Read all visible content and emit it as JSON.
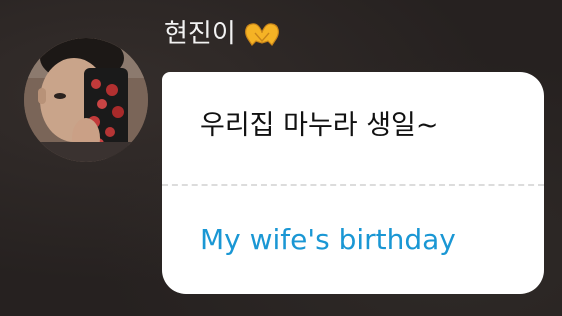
{
  "message": {
    "sender_name": "현진이",
    "sender_emoji_icon": "heart-hands-icon",
    "original_text": "우리집 마누라 생일~",
    "translated_text": "My wife's birthday"
  },
  "colors": {
    "background": "#262120",
    "bubble": "#ffffff",
    "username": "#f2f2f2",
    "original_text": "#111111",
    "translated_text": "#1a97d4",
    "emoji": "#f5b325"
  }
}
